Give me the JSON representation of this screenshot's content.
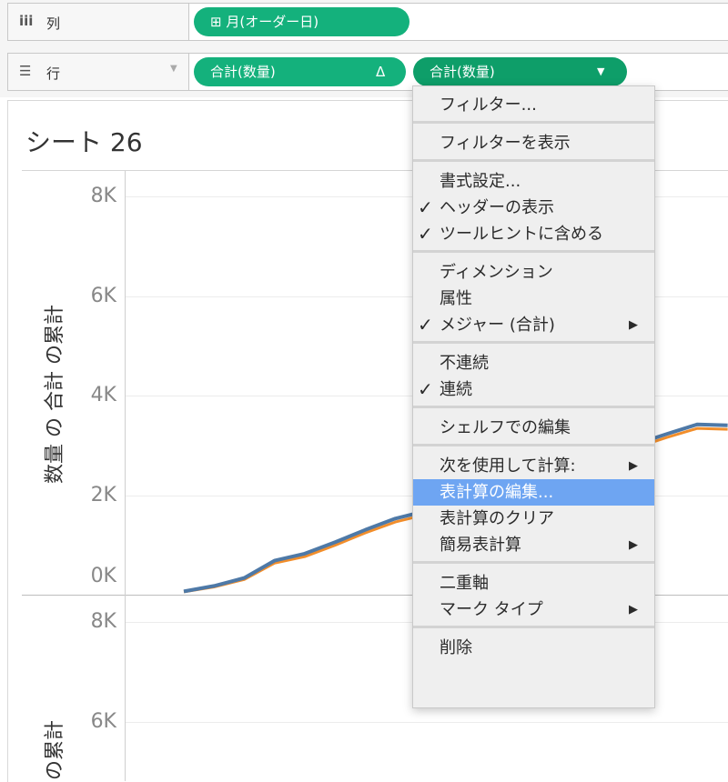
{
  "shelves": {
    "columns": {
      "icon": "iii",
      "label": "列",
      "pills": [
        {
          "text": "⊞ 月(オーダー日)"
        }
      ]
    },
    "rows": {
      "icon": "☰",
      "label": "行",
      "caret": "▼",
      "pills": [
        {
          "text": "合計(数量)",
          "end": "Δ"
        },
        {
          "text": "合計(数量)",
          "end": "▼"
        }
      ]
    }
  },
  "sheet": {
    "title": "シート 26",
    "top_axis": {
      "title": "数量 の 合計 の累計",
      "ticks": [
        "8K",
        "6K",
        "4K",
        "2K",
        "0K"
      ]
    },
    "bottom_axis": {
      "title": "の累計",
      "ticks": [
        "8K",
        "6K"
      ]
    }
  },
  "colors": {
    "pill": "#14b17c",
    "pill_active": "#0e9e69",
    "line_blue": "#4e79a7",
    "line_orange": "#f28e2b",
    "menu_highlight": "#6ea5f2"
  },
  "chart_data": {
    "type": "line",
    "title": "",
    "xlabel": "",
    "ylabel": "数量 の 合計 の累計",
    "ylim": [
      0,
      8000
    ],
    "x": [
      1,
      2,
      3,
      4,
      5,
      6,
      7,
      8,
      9,
      10,
      11,
      12,
      13,
      14,
      15,
      16,
      17,
      18,
      19
    ],
    "series": [
      {
        "color": "#f28e2b",
        "values": [
          20,
          120,
          270,
          600,
          730,
          960,
          1210,
          1430,
          1580,
          1760,
          1960,
          2140,
          2350,
          2530,
          2750,
          2940,
          3140,
          3320,
          3300
        ]
      },
      {
        "color": "#4e79a7",
        "values": [
          30,
          140,
          300,
          650,
          790,
          1020,
          1270,
          1500,
          1650,
          1830,
          2030,
          2210,
          2420,
          2600,
          2820,
          3010,
          3210,
          3400,
          3380
        ]
      }
    ]
  },
  "menu": {
    "groups": [
      [
        {
          "label": "フィルター..."
        }
      ],
      [
        {
          "label": "フィルターを表示"
        }
      ],
      [
        {
          "label": "書式設定..."
        },
        {
          "label": "ヘッダーの表示",
          "check": "✓"
        },
        {
          "label": "ツールヒントに含める",
          "check": "✓"
        }
      ],
      [
        {
          "label": "ディメンション"
        },
        {
          "label": "属性"
        },
        {
          "label": "メジャー (合計)",
          "check": "✓",
          "arrow": "▶"
        }
      ],
      [
        {
          "label": "不連続"
        },
        {
          "label": "連続",
          "check": "✓"
        }
      ],
      [
        {
          "label": "シェルフでの編集"
        }
      ],
      [
        {
          "label": "次を使用して計算:",
          "arrow": "▶"
        },
        {
          "label": "表計算の編集...",
          "highlighted": true
        },
        {
          "label": "表計算のクリア"
        },
        {
          "label": "簡易表計算",
          "arrow": "▶"
        }
      ],
      [
        {
          "label": "二重軸"
        },
        {
          "label": "マーク タイプ",
          "arrow": "▶"
        }
      ],
      [
        {
          "label": "削除"
        }
      ]
    ]
  }
}
